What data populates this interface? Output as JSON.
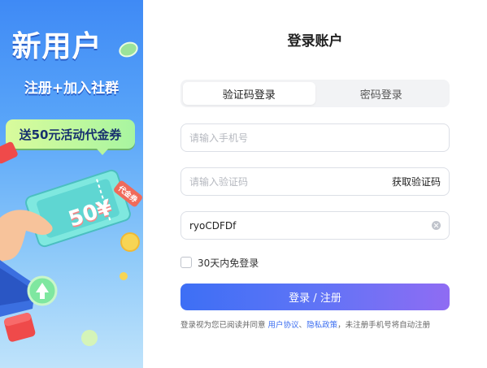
{
  "banner": {
    "title": "新用户",
    "subtitle": "注册+加入社群",
    "voucher": "送50元活动代金券",
    "ticket_amount": "50¥",
    "ticket_tag": "代金券"
  },
  "login": {
    "title": "登录账户",
    "tabs": [
      {
        "label": "验证码登录",
        "active": true
      },
      {
        "label": "密码登录",
        "active": false
      }
    ],
    "phone": {
      "placeholder": "请输入手机号",
      "value": ""
    },
    "code": {
      "placeholder": "请输入验证码",
      "value": "",
      "action_label": "获取验证码"
    },
    "captcha": {
      "value": "ryoCDFDf"
    },
    "remember_label": "30天内免登录",
    "remember_checked": false,
    "submit_label": "登录 / 注册",
    "agreement": {
      "prefix": "登录视为您已阅读并同意 ",
      "user_agreement": "用户协议",
      "separator": "、",
      "privacy_policy": "隐私政策",
      "suffix": "，未注册手机号将自动注册"
    }
  },
  "colors": {
    "accent_blue": "#3d6ff5",
    "accent_purple": "#8f6cf3",
    "link": "#3a6df0",
    "banner_top": "#3f8af5"
  }
}
